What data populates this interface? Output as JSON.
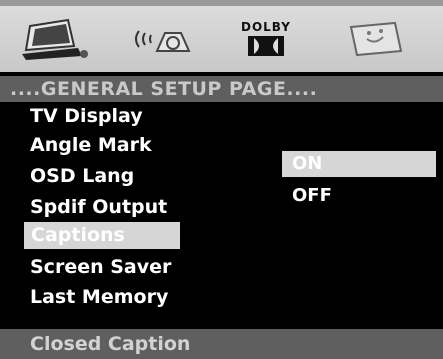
{
  "toolbar": {
    "tabs": [
      {
        "icon": "general-setup-icon"
      },
      {
        "icon": "speaker-audio-icon"
      },
      {
        "icon": "dolby-icon",
        "label": "DOLBY"
      },
      {
        "icon": "preference-icon"
      }
    ]
  },
  "header": {
    "title": "....GENERAL SETUP PAGE...."
  },
  "menu": {
    "items": [
      {
        "label": "TV Display"
      },
      {
        "label": "Angle Mark"
      },
      {
        "label": "OSD Lang"
      },
      {
        "label": "Spdif Output"
      },
      {
        "label": "Captions"
      },
      {
        "label": "Screen Saver"
      },
      {
        "label": "Last Memory"
      }
    ],
    "selected": "Captions"
  },
  "options": {
    "items": [
      {
        "label": "ON"
      },
      {
        "label": "OFF"
      }
    ],
    "selected": "ON"
  },
  "footer": {
    "hint": "Closed Caption"
  },
  "colors": {
    "background": "#000000",
    "header_bar": "#5f5f5f",
    "highlight": "#d6d6d6",
    "icon_bar": "#d0d0d0",
    "text": "#ffffff"
  }
}
